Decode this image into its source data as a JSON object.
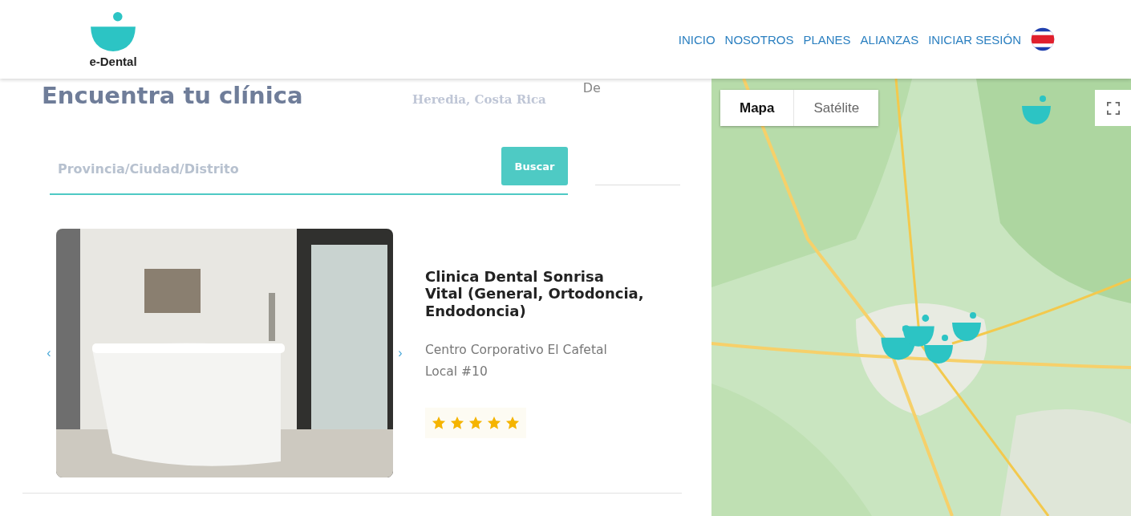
{
  "header": {
    "logo_text": "e-Dental",
    "nav": [
      "INICIO",
      "NOSOTROS",
      "PLANES",
      "ALIANZAS",
      "INICIAR SESIÓN"
    ]
  },
  "search_panel": {
    "title": "Encuentra tu clínica",
    "faded_texts": [
      "Heredia, Costa Rica",
      "De"
    ],
    "search": {
      "placeholder": "Provincia/Ciudad/Distrito",
      "button": "Buscar"
    }
  },
  "clinics": [
    {
      "name": "Clinica Dental Sonrisa Vital (General, Ortodoncia, Endodoncia)",
      "address": "Centro Corporativo El Cafetal Local #10",
      "stars": 5,
      "prev": "‹",
      "next": "›"
    }
  ],
  "map": {
    "map_types": [
      {
        "label": "Mapa",
        "selected": true
      },
      {
        "label": "Satélite",
        "selected": false
      }
    ]
  }
}
